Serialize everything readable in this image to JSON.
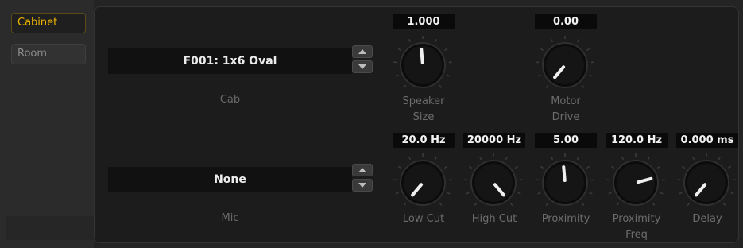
{
  "tabs": {
    "cabinet": "Cabinet",
    "room": "Room"
  },
  "cab": {
    "value": "F001: 1x6 Oval",
    "label": "Cab"
  },
  "mic": {
    "value": "None",
    "label": "Mic"
  },
  "knobs": {
    "speaker_size": {
      "value": "1.000",
      "label1": "Speaker",
      "label2": "Size"
    },
    "motor_drive": {
      "value": "0.00",
      "label1": "Motor",
      "label2": "Drive"
    },
    "low_cut": {
      "value": "20.0 Hz",
      "label1": "Low Cut",
      "label2": ""
    },
    "high_cut": {
      "value": "20000 Hz",
      "label1": "High Cut",
      "label2": ""
    },
    "proximity": {
      "value": "5.00",
      "label1": "Proximity",
      "label2": ""
    },
    "proximity_freq": {
      "value": "120.0 Hz",
      "label1": "Proximity",
      "label2": "Freq"
    },
    "delay": {
      "value": "0.000 ms",
      "label1": "Delay",
      "label2": ""
    }
  },
  "colors": {
    "accent": "#f0b400",
    "panel": "#1c1c1c",
    "value_bg": "#0a0a0a"
  }
}
